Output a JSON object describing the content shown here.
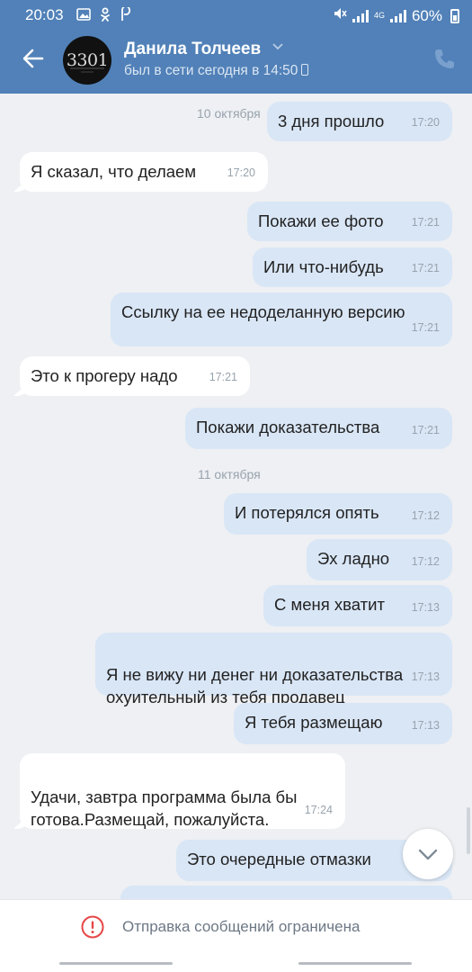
{
  "status_bar": {
    "time": "20:03",
    "network": "4G",
    "battery": "60%"
  },
  "header": {
    "avatar_text": "3301",
    "contact_name": "Данила Толчеев",
    "last_seen": "был в сети сегодня в 14:50"
  },
  "dates": [
    "10 октября",
    "11 октября"
  ],
  "messages": [
    {
      "text": "3 дня прошло",
      "time": "17:20",
      "direction": "out"
    },
    {
      "text": "Я сказал, что делаем",
      "time": "17:20",
      "direction": "in"
    },
    {
      "text": "Покажи ее фото",
      "time": "17:21",
      "direction": "out"
    },
    {
      "text": "Или что-нибудь",
      "time": "17:21",
      "direction": "out"
    },
    {
      "text": "Ссылку на ее недоделанную версию",
      "time": "17:21",
      "direction": "out"
    },
    {
      "text": "Это к прогеру надо",
      "time": "17:21",
      "direction": "in"
    },
    {
      "text": "Покажи доказательства",
      "time": "17:21",
      "direction": "out"
    },
    {
      "text": "И потерялся опять",
      "time": "17:12",
      "direction": "out"
    },
    {
      "text": "Эх ладно",
      "time": "17:12",
      "direction": "out"
    },
    {
      "text": "С меня хватит",
      "time": "17:13",
      "direction": "out"
    },
    {
      "text": "Я не вижу ни денег ни доказательства\nохуительный из тебя продавец",
      "time": "17:13",
      "direction": "out"
    },
    {
      "text": "Я тебя размещаю",
      "time": "17:13",
      "direction": "out"
    },
    {
      "text": "Удачи, завтра программа была бы\nготова.Размещай, пожалуйста.",
      "time": "17:24",
      "direction": "in"
    },
    {
      "text": "Это очередные отмазки",
      "time": "",
      "direction": "out"
    }
  ],
  "restriction_notice": "Отправка сообщений ограничена",
  "colors": {
    "header": "#5181b8",
    "outgoing_bubble": "#d9e6f6",
    "incoming_bubble": "#ffffff",
    "chat_bg": "#eef0f3",
    "warning": "#e64646"
  }
}
